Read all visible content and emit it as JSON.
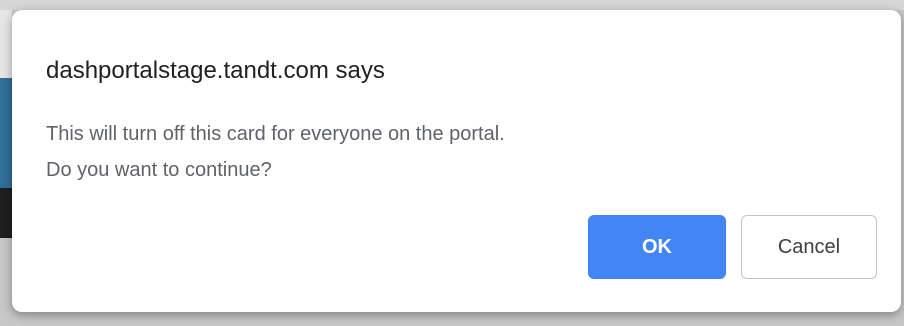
{
  "dialog": {
    "title": "dashportalstage.tandt.com says",
    "message_lines": [
      "This will turn off this card for everyone on the portal.",
      "Do you want to continue?"
    ],
    "ok_label": "OK",
    "cancel_label": "Cancel"
  },
  "colors": {
    "ok_button": "#4285f4",
    "dialog_background": "#ffffff",
    "title_text": "#202124",
    "message_text": "#5f6368"
  }
}
